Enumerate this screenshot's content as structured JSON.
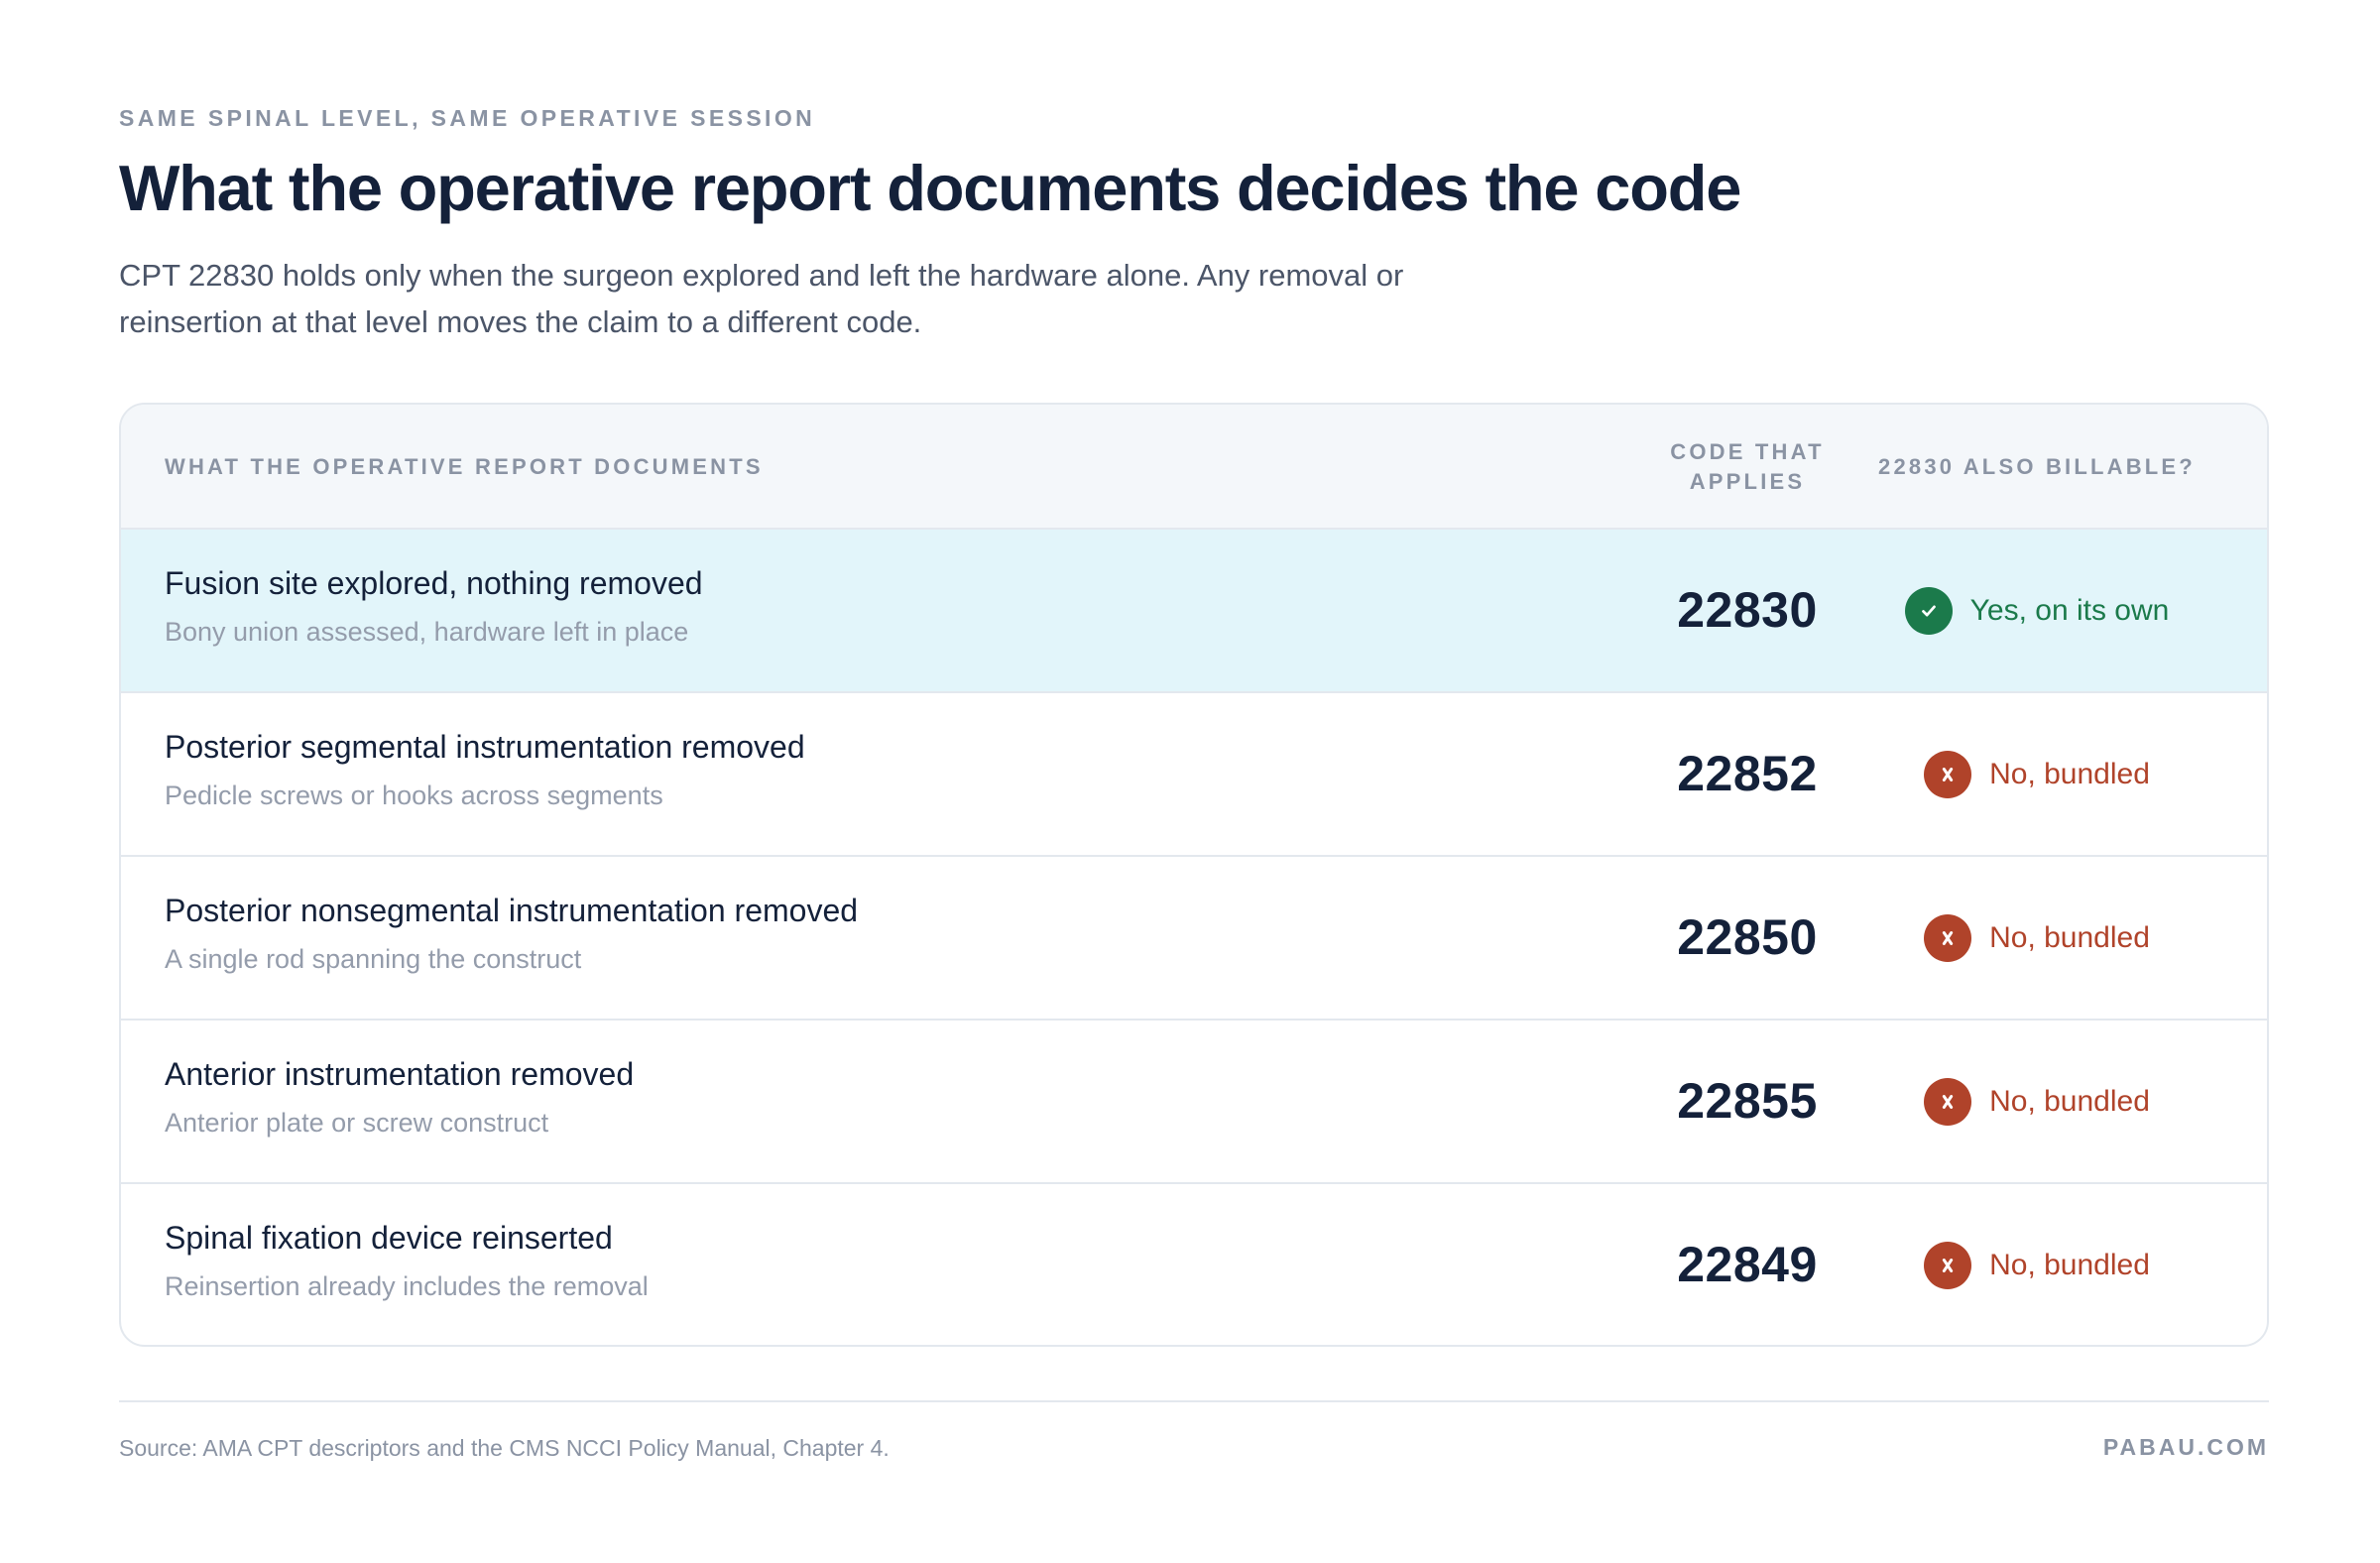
{
  "header": {
    "eyebrow": "SAME SPINAL LEVEL, SAME OPERATIVE SESSION",
    "title": "What the operative report documents decides the code",
    "subtitle": "CPT 22830 holds only when the surgeon explored and left the hardware alone. Any removal or reinsertion at that level moves the claim to a different code."
  },
  "table": {
    "columns": {
      "description": "WHAT THE OPERATIVE REPORT DOCUMENTS",
      "code": "CODE THAT APPLIES",
      "billable": "22830 ALSO BILLABLE?"
    },
    "rows": [
      {
        "title": "Fusion site explored, nothing removed",
        "subtitle": "Bony union assessed, hardware left in place",
        "code": "22830",
        "billable": "Yes, on its own",
        "status": "yes",
        "icon": "check-icon",
        "highlighted": true
      },
      {
        "title": "Posterior segmental instrumentation removed",
        "subtitle": "Pedicle screws or hooks across segments",
        "code": "22852",
        "billable": "No, bundled",
        "status": "no",
        "icon": "cross-icon",
        "highlighted": false
      },
      {
        "title": "Posterior nonsegmental instrumentation removed",
        "subtitle": "A single rod spanning the construct",
        "code": "22850",
        "billable": "No, bundled",
        "status": "no",
        "icon": "cross-icon",
        "highlighted": false
      },
      {
        "title": "Anterior instrumentation removed",
        "subtitle": "Anterior plate or screw construct",
        "code": "22855",
        "billable": "No, bundled",
        "status": "no",
        "icon": "cross-icon",
        "highlighted": false
      },
      {
        "title": "Spinal fixation device reinserted",
        "subtitle": "Reinsertion already includes the removal",
        "code": "22849",
        "billable": "No, bundled",
        "status": "no",
        "icon": "cross-icon",
        "highlighted": false
      }
    ]
  },
  "footer": {
    "source": "Source: AMA CPT descriptors and the CMS NCCI Policy Manual, Chapter 4.",
    "brand": "PABAU.COM"
  },
  "colors": {
    "yes": "#1b7a4b",
    "no": "#b0432a",
    "highlight_row": "#e2f5fa",
    "header_bg": "#f4f7fa"
  }
}
